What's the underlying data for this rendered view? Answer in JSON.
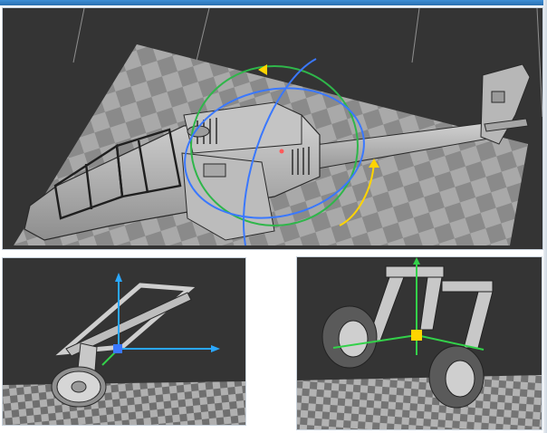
{
  "app": {
    "name": "",
    "colors": {
      "viewport_bg": "#343434",
      "bed_light": "#a9a9a9",
      "bed_dark": "#8a8a8a",
      "model_gray": "#b9b9b9",
      "axis_x": "#2aa7ff",
      "axis_y": "#33d14a",
      "axis_z": "#ffd400",
      "gizmo_blue": "#3a78ff",
      "gizmo_green": "#2fb64a"
    }
  },
  "viewports": [
    {
      "id": "main",
      "content": "helicopter-model",
      "gizmo": "rotate-gizmo"
    },
    {
      "id": "bottom-left",
      "content": "landing-gear-strut",
      "gizmo": "move-gizmo"
    },
    {
      "id": "bottom-right",
      "content": "tail-wheel-assembly",
      "gizmo": "move-gizmo"
    }
  ]
}
